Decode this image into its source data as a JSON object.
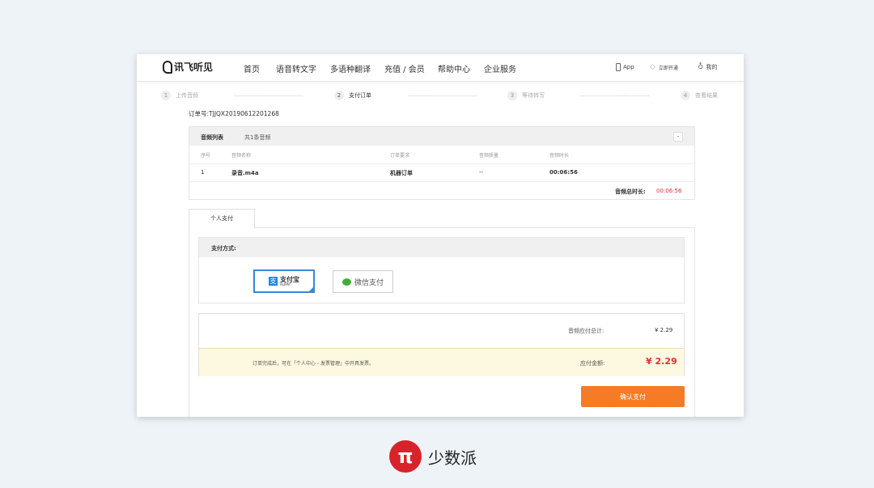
{
  "brand": {
    "logo": "讯飞听见"
  },
  "nav": {
    "items": [
      "首页",
      "语音转文字",
      "多语种翻译",
      "充值 / 会员",
      "帮助中心",
      "企业服务"
    ],
    "app": "App",
    "vip": "立即开通",
    "mine": "我的"
  },
  "steps": [
    {
      "num": "1",
      "label": "上传音频"
    },
    {
      "num": "2",
      "label": "支付订单"
    },
    {
      "num": "3",
      "label": "等待转写"
    },
    {
      "num": "4",
      "label": "查看结果"
    }
  ],
  "order_no": "订单号:TJJQX20190612201268",
  "audio_list": {
    "title": "音频列表",
    "count": "共1条音频",
    "collapse": "-",
    "headers": [
      "序号",
      "音频名称",
      "订单要求",
      "音频质量",
      "音频时长"
    ],
    "rows": [
      [
        "1",
        "录音.m4a",
        "机器订单",
        "--",
        "00:06:56"
      ]
    ],
    "total_label": "音频总时长:",
    "total_value": "00:06:56"
  },
  "tab": "个人支付",
  "payment": {
    "label": "支付方式:",
    "alipay": "支付宝",
    "alipay_sub": "ALIPAY",
    "wechat": "微信支付"
  },
  "summary": {
    "subtotal_label": "音频应付总计:",
    "subtotal": "¥ 2.29",
    "note": "订单完成后，可在「个人中心 - 发票管理」中开具发票。",
    "due_label": "应付金额:",
    "due": "¥ 2.29"
  },
  "confirm": "确认支付",
  "watermark": "少数派",
  "colors": {
    "accent": "#f57b24",
    "red": "#e0303a",
    "alipay": "#1a8cea",
    "wechat": "#3cb034"
  }
}
